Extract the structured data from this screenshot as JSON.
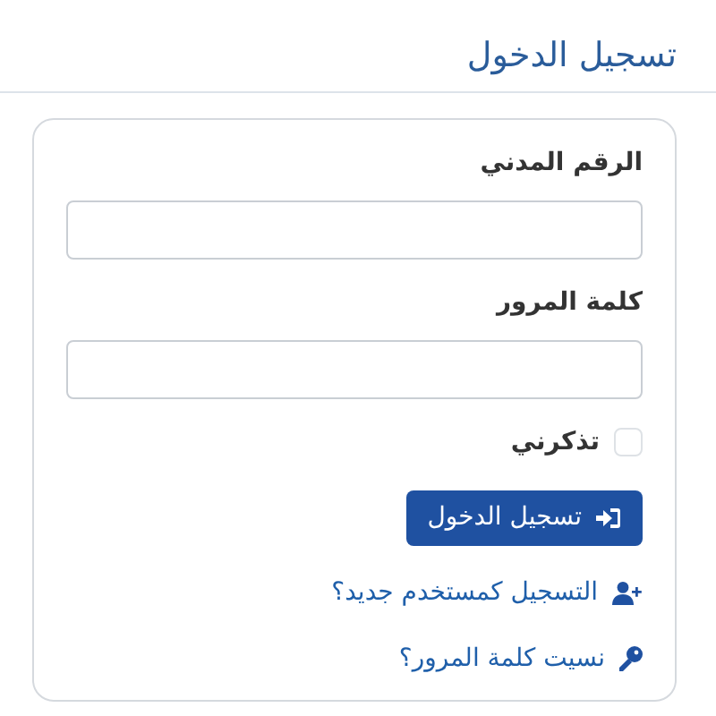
{
  "title": "تسجيل الدخول",
  "fields": [
    {
      "label": "الرقم المدني"
    },
    {
      "label": "كلمة المرور"
    }
  ],
  "remember": {
    "label": "تذكرني",
    "checked": false
  },
  "submit": {
    "label": "تسجيل الدخول"
  },
  "links": [
    {
      "kind": "register",
      "label": "التسجيل كمستخدم جديد؟"
    },
    {
      "kind": "forgot",
      "label": "نسيت كلمة المرور؟"
    }
  ]
}
